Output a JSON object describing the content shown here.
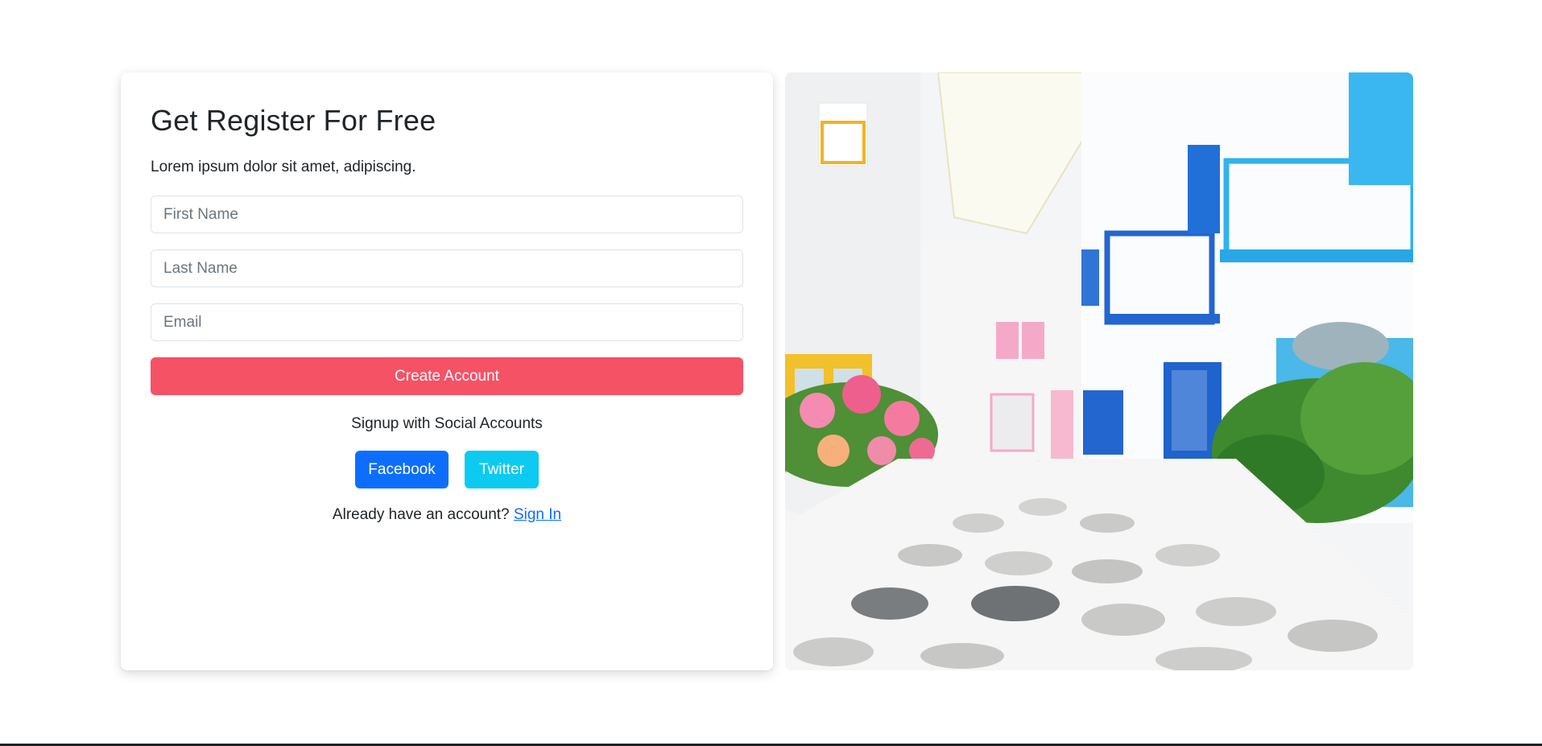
{
  "form": {
    "title": "Get Register For Free",
    "subtitle": "Lorem ipsum dolor sit amet, adipiscing.",
    "first_name_placeholder": "First Name",
    "last_name_placeholder": "Last Name",
    "email_placeholder": "Email",
    "create_label": "Create Account",
    "social_label": "Signup with Social Accounts",
    "facebook_label": "Facebook",
    "twitter_label": "Twitter",
    "signin_prompt": "Already have an account?",
    "signin_link": "Sign In"
  },
  "colors": {
    "primary_button": "#f55266",
    "facebook": "#0d6efd",
    "twitter": "#0dcaf0",
    "link": "#0d6efd"
  },
  "image": {
    "icon": "street-photo-image"
  }
}
